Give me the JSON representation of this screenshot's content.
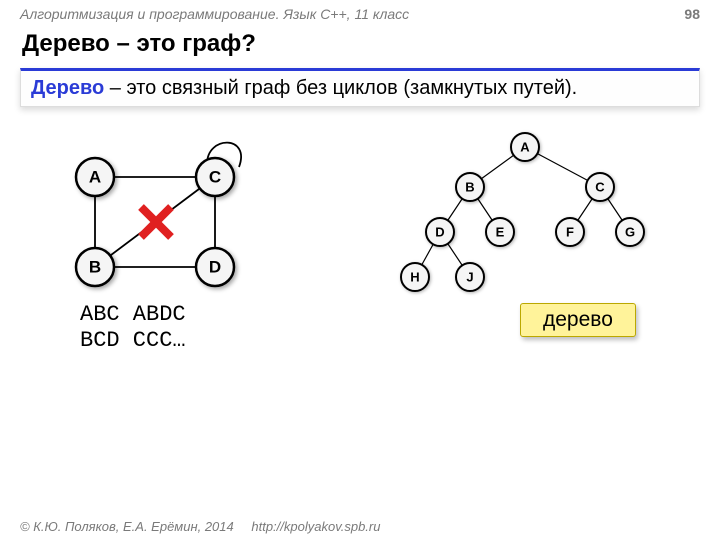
{
  "header": {
    "course": "Алгоритмизация и программирование. Язык С++, 11 класс",
    "page": "98"
  },
  "title": "Дерево – это граф?",
  "definition": {
    "term": "Дерево",
    "rest": " – это связный граф без циклов (замкнутых путей)."
  },
  "graph": {
    "nodes": {
      "A": "A",
      "B": "B",
      "C": "C",
      "D": "D"
    }
  },
  "cycles": {
    "line1": "ABC ABDC",
    "line2": "BCD CCC…"
  },
  "tree": {
    "nodes": {
      "A": "A",
      "B": "B",
      "C": "C",
      "D": "D",
      "E": "E",
      "F": "F",
      "G": "G",
      "H": "H",
      "J": "J"
    },
    "label": "дерево"
  },
  "footer": {
    "copyright": "© К.Ю. Поляков, Е.А. Ерёмин, 2014",
    "url": "http://kpolyakov.spb.ru"
  }
}
